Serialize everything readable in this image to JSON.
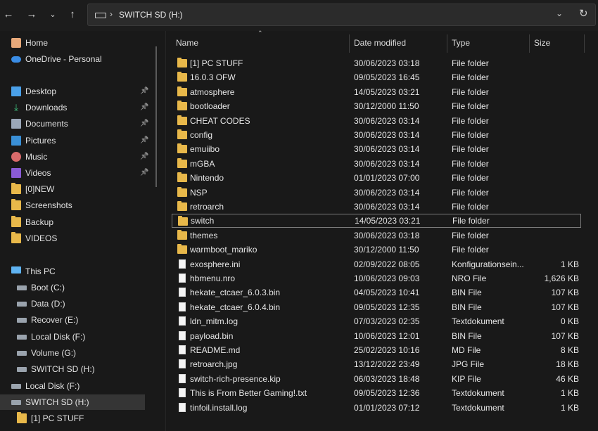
{
  "toolbar": {
    "back_icon": "arrow-left-icon",
    "forward_icon": "arrow-right-icon",
    "recent_icon": "chevron-down-icon",
    "up_icon": "arrow-up-icon",
    "address_path": "SWITCH SD (H:)",
    "refresh_icon": "refresh-icon"
  },
  "sidebar": {
    "top": [
      {
        "label": "Home",
        "icon": "home-icon"
      },
      {
        "label": "OneDrive - Personal",
        "icon": "cloud-icon"
      }
    ],
    "quick": [
      {
        "label": "Desktop",
        "icon": "desktop-icon",
        "pinned": true
      },
      {
        "label": "Downloads",
        "icon": "download-icon",
        "pinned": true
      },
      {
        "label": "Documents",
        "icon": "documents-icon",
        "pinned": true
      },
      {
        "label": "Pictures",
        "icon": "pictures-icon",
        "pinned": true
      },
      {
        "label": "Music",
        "icon": "music-icon",
        "pinned": true
      },
      {
        "label": "Videos",
        "icon": "videos-icon",
        "pinned": true
      },
      {
        "label": "[0]NEW",
        "icon": "folder-icon",
        "pinned": false
      },
      {
        "label": "Screenshots",
        "icon": "folder-icon",
        "pinned": false
      },
      {
        "label": "Backup",
        "icon": "folder-icon",
        "pinned": false
      },
      {
        "label": "VIDEOS",
        "icon": "folder-icon",
        "pinned": false
      }
    ],
    "this_pc": {
      "label": "This PC",
      "icon": "pc-icon"
    },
    "drives": [
      {
        "label": "Boot (C:)"
      },
      {
        "label": "Data (D:)"
      },
      {
        "label": "Recover (E:)"
      },
      {
        "label": "Local Disk (F:)"
      },
      {
        "label": "Volume (G:)"
      },
      {
        "label": "SWITCH SD (H:)"
      }
    ],
    "bottom": [
      {
        "label": "Local Disk (F:)"
      },
      {
        "label": "SWITCH SD (H:)"
      },
      {
        "label": "[1] PC STUFF"
      }
    ]
  },
  "columns": {
    "name": "Name",
    "date": "Date modified",
    "type": "Type",
    "size": "Size"
  },
  "files": [
    {
      "name": "[1] PC STUFF",
      "date": "30/06/2023 03:18",
      "type": "File folder",
      "size": "",
      "kind": "folder"
    },
    {
      "name": "16.0.3 OFW",
      "date": "09/05/2023 16:45",
      "type": "File folder",
      "size": "",
      "kind": "folder"
    },
    {
      "name": "atmosphere",
      "date": "14/05/2023 03:21",
      "type": "File folder",
      "size": "",
      "kind": "folder"
    },
    {
      "name": "bootloader",
      "date": "30/12/2000 11:50",
      "type": "File folder",
      "size": "",
      "kind": "folder"
    },
    {
      "name": "CHEAT CODES",
      "date": "30/06/2023 03:14",
      "type": "File folder",
      "size": "",
      "kind": "folder"
    },
    {
      "name": "config",
      "date": "30/06/2023 03:14",
      "type": "File folder",
      "size": "",
      "kind": "folder"
    },
    {
      "name": "emuiibo",
      "date": "30/06/2023 03:14",
      "type": "File folder",
      "size": "",
      "kind": "folder"
    },
    {
      "name": "mGBA",
      "date": "30/06/2023 03:14",
      "type": "File folder",
      "size": "",
      "kind": "folder"
    },
    {
      "name": "Nintendo",
      "date": "01/01/2023 07:00",
      "type": "File folder",
      "size": "",
      "kind": "folder"
    },
    {
      "name": "NSP",
      "date": "30/06/2023 03:14",
      "type": "File folder",
      "size": "",
      "kind": "folder"
    },
    {
      "name": "retroarch",
      "date": "30/06/2023 03:14",
      "type": "File folder",
      "size": "",
      "kind": "folder"
    },
    {
      "name": "switch",
      "date": "14/05/2023 03:21",
      "type": "File folder",
      "size": "",
      "kind": "folder",
      "selected": true
    },
    {
      "name": "themes",
      "date": "30/06/2023 03:18",
      "type": "File folder",
      "size": "",
      "kind": "folder"
    },
    {
      "name": "warmboot_mariko",
      "date": "30/12/2000 11:50",
      "type": "File folder",
      "size": "",
      "kind": "folder"
    },
    {
      "name": "exosphere.ini",
      "date": "02/09/2022 08:05",
      "type": "Konfigurationsein...",
      "size": "1 KB",
      "kind": "file"
    },
    {
      "name": "hbmenu.nro",
      "date": "10/06/2023 09:03",
      "type": "NRO File",
      "size": "1,626 KB",
      "kind": "file"
    },
    {
      "name": "hekate_ctcaer_6.0.3.bin",
      "date": "04/05/2023 10:41",
      "type": "BIN File",
      "size": "107 KB",
      "kind": "file"
    },
    {
      "name": "hekate_ctcaer_6.0.4.bin",
      "date": "09/05/2023 12:35",
      "type": "BIN File",
      "size": "107 KB",
      "kind": "file"
    },
    {
      "name": "ldn_mitm.log",
      "date": "07/03/2023 02:35",
      "type": "Textdokument",
      "size": "0 KB",
      "kind": "file"
    },
    {
      "name": "payload.bin",
      "date": "10/06/2023 12:01",
      "type": "BIN File",
      "size": "107 KB",
      "kind": "file"
    },
    {
      "name": "README.md",
      "date": "25/02/2023 10:16",
      "type": "MD File",
      "size": "8 KB",
      "kind": "file"
    },
    {
      "name": "retroarch.jpg",
      "date": "13/12/2022 23:49",
      "type": "JPG File",
      "size": "18 KB",
      "kind": "file"
    },
    {
      "name": "switch-rich-presence.kip",
      "date": "06/03/2023 18:48",
      "type": "KIP File",
      "size": "46 KB",
      "kind": "file"
    },
    {
      "name": "This is From Better Gaming!.txt",
      "date": "09/05/2023 12:36",
      "type": "Textdokument",
      "size": "1 KB",
      "kind": "file"
    },
    {
      "name": "tinfoil.install.log",
      "date": "01/01/2023 07:12",
      "type": "Textdokument",
      "size": "1 KB",
      "kind": "file"
    }
  ]
}
